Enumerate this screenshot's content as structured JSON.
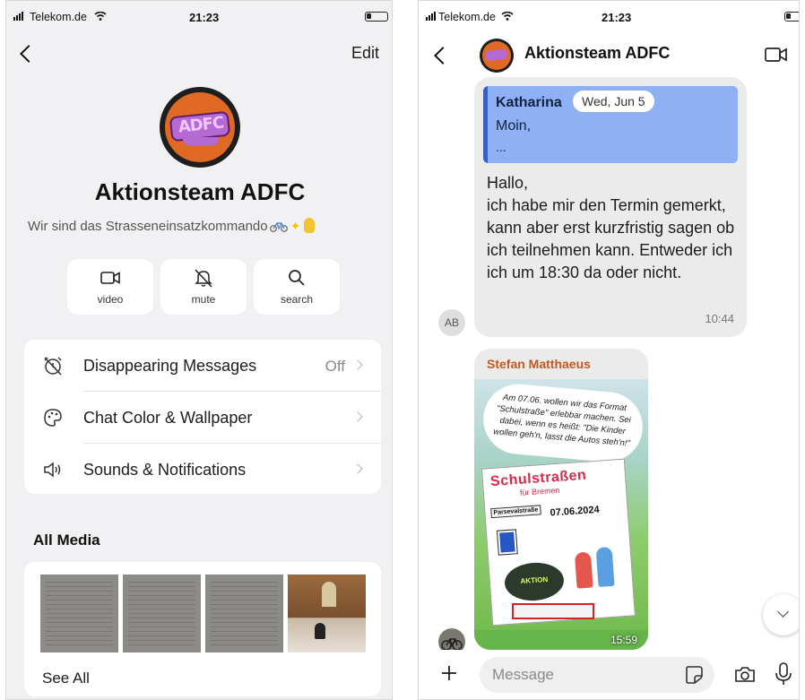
{
  "left_screen": {
    "status_bar": {
      "carrier": "Telekom.de",
      "time": "21:23"
    },
    "nav": {
      "edit_label": "Edit"
    },
    "group": {
      "name": "Aktionsteam ADFC",
      "description": "Wir sind das Strasseneinsatzkommando",
      "avatar_text": "ADFC"
    },
    "actions": [
      {
        "label": "video",
        "icon": "video-icon"
      },
      {
        "label": "mute",
        "icon": "bell-slash-icon"
      },
      {
        "label": "search",
        "icon": "search-icon"
      }
    ],
    "settings": [
      {
        "label": "Disappearing Messages",
        "value": "Off",
        "icon": "timer-off-icon"
      },
      {
        "label": "Chat Color & Wallpaper",
        "value": "",
        "icon": "palette-icon"
      },
      {
        "label": "Sounds & Notifications",
        "value": "",
        "icon": "speaker-icon"
      }
    ],
    "media": {
      "header": "All Media",
      "see_all": "See All",
      "thumbnail_count": 4
    }
  },
  "right_screen": {
    "status_bar": {
      "carrier": "Telekom.de",
      "time": "21:23"
    },
    "header": {
      "title": "Aktionsteam ADFC",
      "avatar_text": "ADFC"
    },
    "messages": [
      {
        "sender_initials": "AB",
        "quote": {
          "author": "Katharina",
          "date": "Wed, Jun 5",
          "line1": "Moin,",
          "line2": "..."
        },
        "text": "Hallo,\nich habe mir den Termin gemerkt, kann aber erst kurzfristig sagen ob ich teilnehmen kann. Entweder ich ich um 18:30 da oder nicht.",
        "time": "10:44"
      },
      {
        "sender": "Stefan Matthaeus",
        "image": {
          "speech_text": "Am 07.06. wollen wir das Format \"Schulstraße\" erlebbar machen. Sei dabei, wenn es heißt: \"Die Kinder wollen geh'n, lasst die Autos steh'n!\"",
          "poster_title": "Schulstraßen",
          "poster_subtitle": "für Bremen",
          "poster_date": "07.06.2024",
          "poster_street": "Parsevalstraße",
          "poster_action": "AKTION"
        },
        "time": "15:59"
      }
    ],
    "composer": {
      "placeholder": "Message"
    }
  },
  "colors": {
    "quote_bg": "#8fb0f5",
    "quote_bar": "#2e5fd3",
    "avatar_orange": "#e06a23",
    "sender_name": "#c4581f"
  }
}
